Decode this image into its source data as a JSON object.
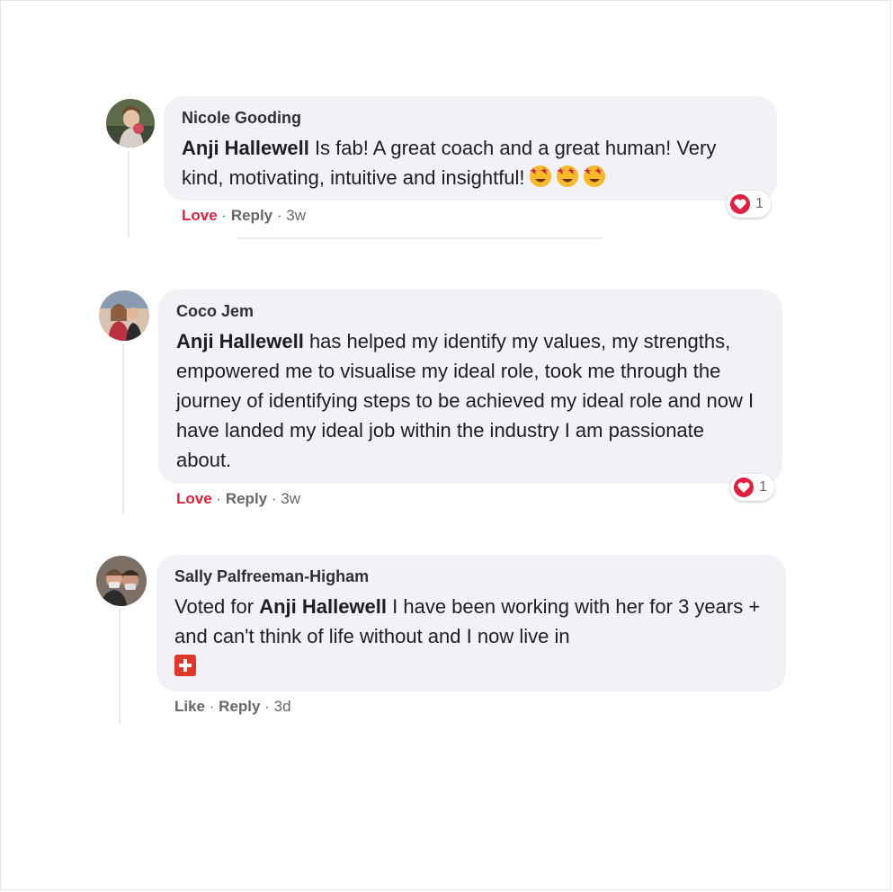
{
  "comments": [
    {
      "author": "Nicole Gooding",
      "mention": "Anji Hallewell",
      "text_after_mention": " Is fab! A great coach and a great human! Very kind, motivating, intuitive and insightful!",
      "emojis": [
        "star-struck-icon",
        "star-struck-icon",
        "star-struck-icon"
      ],
      "actions": {
        "reaction": "Love",
        "reply": "Reply",
        "time": "3w"
      },
      "reaction_count": "1"
    },
    {
      "author": "Coco Jem",
      "mention": "Anji Hallewell",
      "text_after_mention": " has helped my identify my values, my strengths, empowered me to visualise my ideal role, took me through the journey of identifying steps to be achieved my ideal role and now I have landed my ideal job within the industry I am passionate about.",
      "actions": {
        "reaction": "Love",
        "reply": "Reply",
        "time": "3w"
      },
      "reaction_count": "1"
    },
    {
      "author": "Sally Palfreeman-Higham",
      "text_before_mention": "Voted for ",
      "mention": "Anji Hallewell",
      "text_after_mention": " I have been working with her for 3 years + and can't think of life without and I now live in",
      "flag_icon": "swiss-flag-icon",
      "actions": {
        "reaction": "Like",
        "reply": "Reply",
        "time": "3d"
      }
    }
  ],
  "separator": "·",
  "colors": {
    "love": "#e41e3f",
    "bubble": "#f0f2f5",
    "meta": "#65676b"
  }
}
